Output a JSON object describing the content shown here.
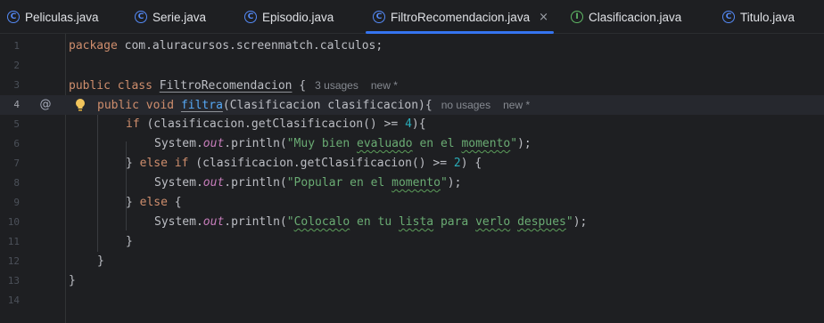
{
  "tabs": [
    {
      "label": "Peliculas.java",
      "icon": "class-icon",
      "active": false
    },
    {
      "label": "Serie.java",
      "icon": "class-icon",
      "active": false
    },
    {
      "label": "Episodio.java",
      "icon": "class-icon",
      "active": false
    },
    {
      "label": "FiltroRecomendacion.java",
      "icon": "class-icon",
      "active": true
    },
    {
      "label": "Clasificacion.java",
      "icon": "interface-icon",
      "active": false
    },
    {
      "label": "Titulo.java",
      "icon": "class-icon",
      "active": false
    }
  ],
  "tab_icon_glyphs": {
    "class": "C",
    "interface": "I"
  },
  "close_glyph": "×",
  "line_numbers": [
    "1",
    "2",
    "3",
    "4",
    "5",
    "6",
    "7",
    "8",
    "9",
    "10",
    "11",
    "12",
    "13",
    "14"
  ],
  "current_line": 4,
  "code": {
    "l1_kw": "package",
    "l1_rest": " com.aluracursos.screenmatch.calculos;",
    "l3_kw1": "public",
    "l3_kw2": "class",
    "l3_name": "FiltroRecomendacion",
    "l3_brace": " {",
    "l3_hint_usages": "3 usages",
    "l3_hint_new": "new *",
    "l4_kw1": "public",
    "l4_kw2": "void",
    "l4_method": "filtra",
    "l4_rest": "(Clasificacion clasificacion){",
    "l4_hint_usages": "no usages",
    "l4_hint_new": "new *",
    "l5_kw": "if",
    "l5_rest": " (clasificacion.getClasificacion() >= ",
    "l5_num": "4",
    "l5_end": "){",
    "l6_pre": "System.",
    "l6_out": "out",
    "l6_mid": ".println(",
    "l6_str_a": "\"Muy bien ",
    "l6_str_b": "evaluado",
    "l6_str_c": " en el ",
    "l6_str_d": "momento",
    "l6_str_e": "\"",
    "l6_end": ");",
    "l7_brace": "} ",
    "l7_kw1": "else",
    "l7_kw2": "if",
    "l7_rest": " (clasificacion.getClasificacion() >= ",
    "l7_num": "2",
    "l7_end": ") {",
    "l8_pre": "System.",
    "l8_out": "out",
    "l8_mid": ".println(",
    "l8_str_a": "\"Popular en el ",
    "l8_str_b": "momento",
    "l8_str_c": "\"",
    "l8_end": ");",
    "l9_brace": "} ",
    "l9_kw": "else",
    "l9_end": " {",
    "l10_pre": "System.",
    "l10_out": "out",
    "l10_mid": ".println(",
    "l10_str_a": "\"",
    "l10_str_b": "Colocalo",
    "l10_str_c": " en tu ",
    "l10_str_d": "lista",
    "l10_str_e": " para ",
    "l10_str_f": "verlo",
    "l10_str_g": " ",
    "l10_str_h": "despues",
    "l10_str_i": "\"",
    "l10_end": ");",
    "l11": "}",
    "l12": "}",
    "l13": "}"
  },
  "gutter_annotation_glyph": "@",
  "colors": {
    "background": "#1e1f22",
    "keyword": "#cf8e6d",
    "string": "#6aab73",
    "number": "#2aacb8",
    "static_field": "#c77dbb",
    "method_decl": "#56a8f5",
    "active_tab_underline": "#3574f0",
    "class_icon": "#548af7",
    "interface_icon": "#5fb865",
    "intention_bulb": "#f2c55c"
  }
}
